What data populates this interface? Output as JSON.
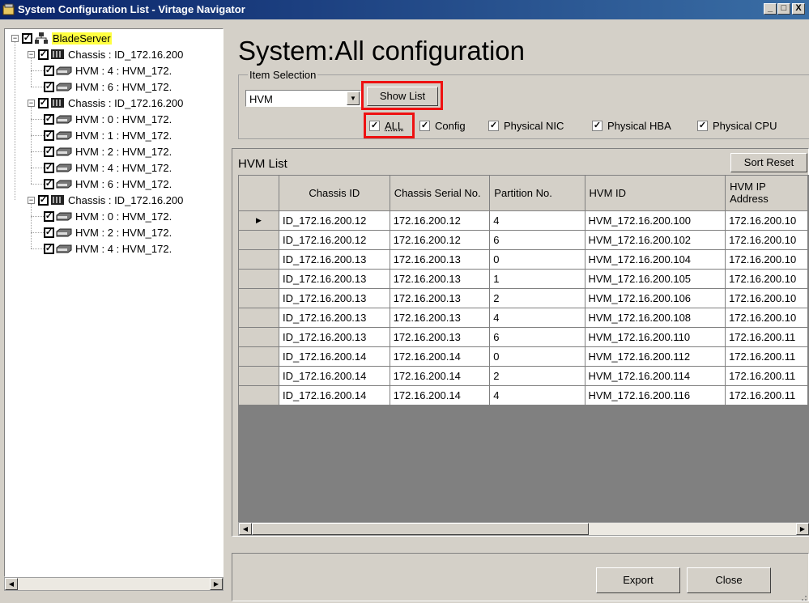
{
  "window": {
    "title": "System Configuration List - Virtage Navigator",
    "minimize_glyph": "_",
    "maximize_glyph": "□",
    "close_glyph": "X"
  },
  "tree": {
    "root": {
      "label": "BladeServer",
      "highlight": "#ffff40"
    },
    "nodes": [
      {
        "level": 1,
        "label": "Chassis : ID_172.16.200",
        "icon": "chassis-icon"
      },
      {
        "level": 2,
        "label": "HVM : 4 : HVM_172.",
        "icon": "server-icon"
      },
      {
        "level": 2,
        "label": "HVM : 6 : HVM_172.",
        "icon": "server-icon"
      },
      {
        "level": 1,
        "label": "Chassis : ID_172.16.200",
        "icon": "chassis-icon"
      },
      {
        "level": 2,
        "label": "HVM : 0 : HVM_172.",
        "icon": "server-icon"
      },
      {
        "level": 2,
        "label": "HVM : 1 : HVM_172.",
        "icon": "server-icon"
      },
      {
        "level": 2,
        "label": "HVM : 2 : HVM_172.",
        "icon": "server-icon"
      },
      {
        "level": 2,
        "label": "HVM : 4 : HVM_172.",
        "icon": "server-icon"
      },
      {
        "level": 2,
        "label": "HVM : 6 : HVM_172.",
        "icon": "server-icon"
      },
      {
        "level": 1,
        "label": "Chassis : ID_172.16.200",
        "icon": "chassis-icon"
      },
      {
        "level": 2,
        "label": "HVM : 0 : HVM_172.",
        "icon": "server-icon"
      },
      {
        "level": 2,
        "label": "HVM : 2 : HVM_172.",
        "icon": "server-icon"
      },
      {
        "level": 2,
        "label": "HVM : 4 : HVM_172.",
        "icon": "server-icon"
      }
    ]
  },
  "main": {
    "title": "System:All configuration",
    "item_selection": {
      "label": "Item Selection",
      "selected": "HVM",
      "show_list_label": "Show List"
    },
    "checkboxes": [
      {
        "label": "ALL",
        "checked": true
      },
      {
        "label": "Config",
        "checked": true
      },
      {
        "label": "Physical NIC",
        "checked": true
      },
      {
        "label": "Physical HBA",
        "checked": true
      },
      {
        "label": "Physical CPU",
        "checked": true
      }
    ],
    "highlight_color": "#e11111"
  },
  "hvm_list": {
    "title": "HVM List",
    "sort_reset_label": "Sort Reset",
    "columns": [
      "Chassis ID",
      "Chassis Serial No.",
      "Partition No.",
      "HVM ID",
      "HVM IP Address"
    ],
    "rows": [
      [
        "ID_172.16.200.12",
        "172.16.200.12",
        "4",
        "HVM_172.16.200.100",
        "172.16.200.10"
      ],
      [
        "ID_172.16.200.12",
        "172.16.200.12",
        "6",
        "HVM_172.16.200.102",
        "172.16.200.10"
      ],
      [
        "ID_172.16.200.13",
        "172.16.200.13",
        "0",
        "HVM_172.16.200.104",
        "172.16.200.10"
      ],
      [
        "ID_172.16.200.13",
        "172.16.200.13",
        "1",
        "HVM_172.16.200.105",
        "172.16.200.10"
      ],
      [
        "ID_172.16.200.13",
        "172.16.200.13",
        "2",
        "HVM_172.16.200.106",
        "172.16.200.10"
      ],
      [
        "ID_172.16.200.13",
        "172.16.200.13",
        "4",
        "HVM_172.16.200.108",
        "172.16.200.10"
      ],
      [
        "ID_172.16.200.13",
        "172.16.200.13",
        "6",
        "HVM_172.16.200.110",
        "172.16.200.11"
      ],
      [
        "ID_172.16.200.14",
        "172.16.200.14",
        "0",
        "HVM_172.16.200.112",
        "172.16.200.11"
      ],
      [
        "ID_172.16.200.14",
        "172.16.200.14",
        "2",
        "HVM_172.16.200.114",
        "172.16.200.11"
      ],
      [
        "ID_172.16.200.14",
        "172.16.200.14",
        "4",
        "HVM_172.16.200.116",
        "172.16.200.11"
      ]
    ],
    "current_row_marker": "▶"
  },
  "footer": {
    "export_label": "Export",
    "close_label": "Close"
  }
}
